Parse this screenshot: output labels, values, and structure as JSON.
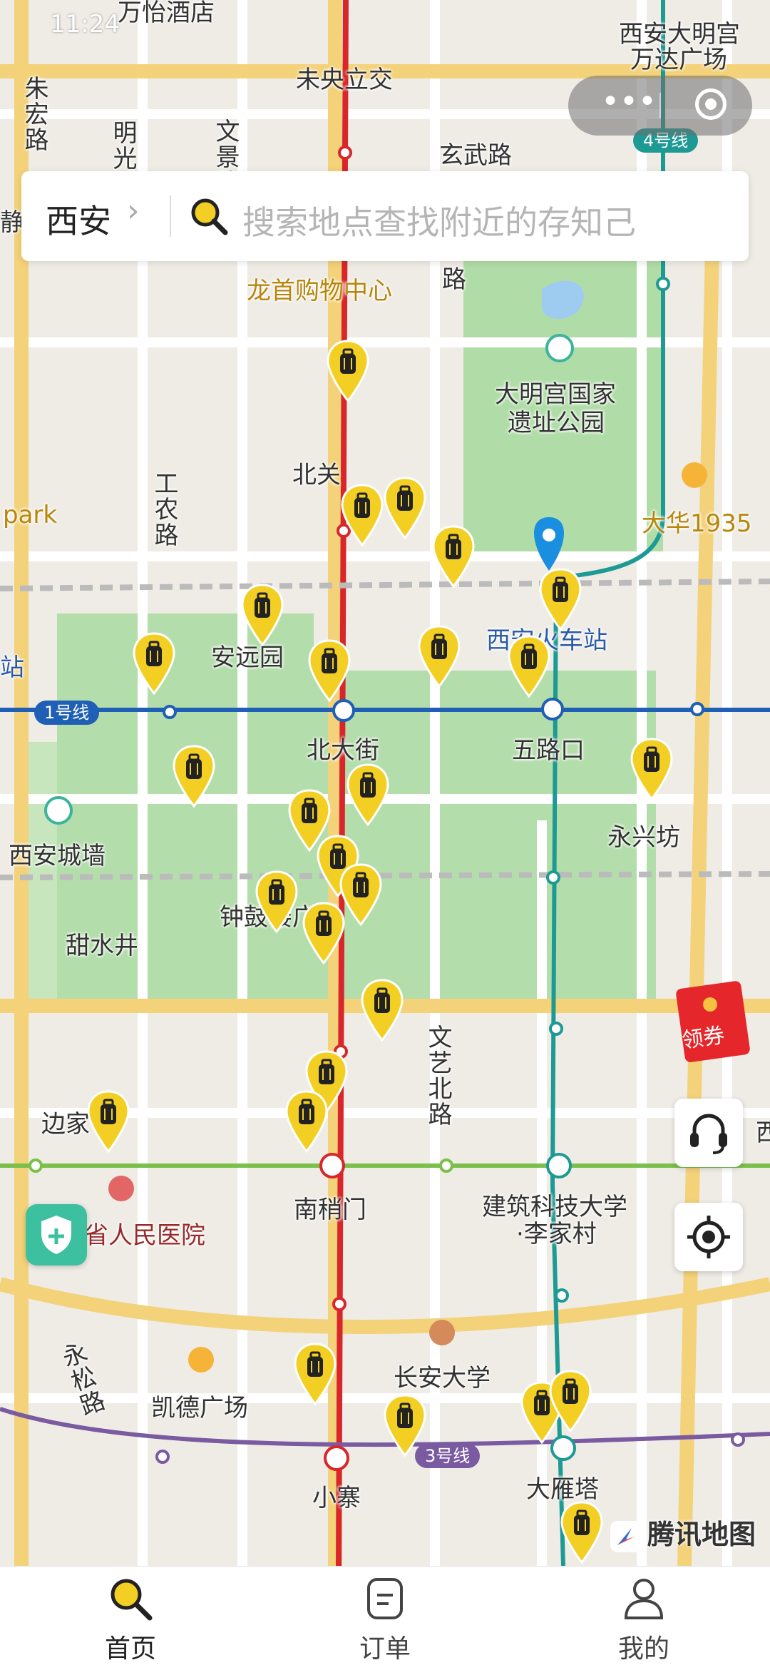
{
  "status_bar": {
    "time": "11:24"
  },
  "search": {
    "city": "西安",
    "city_chevron": "›",
    "placeholder": "搜索地点查找附近的存知己"
  },
  "capsule": {
    "more_label": "•••"
  },
  "map": {
    "labels": [
      {
        "text": "万怡酒店"
      },
      {
        "text": "西安大明宫"
      },
      {
        "text": "万达广场"
      },
      {
        "text": "未央立交"
      },
      {
        "text": "朱宏路"
      },
      {
        "text": "明光路"
      },
      {
        "text": "文景路"
      },
      {
        "text": "玄武路"
      },
      {
        "text": "路"
      },
      {
        "text": "静县"
      },
      {
        "text": "龙首购物中心"
      },
      {
        "text": "大明宫国家"
      },
      {
        "text": "遗址公园"
      },
      {
        "text": "北关"
      },
      {
        "text": "工农路"
      },
      {
        "text": "park"
      },
      {
        "text": "大华1935"
      },
      {
        "text": "西安火车站"
      },
      {
        "text": "安远园"
      },
      {
        "text": "站"
      },
      {
        "text": "北大街"
      },
      {
        "text": "五路口"
      },
      {
        "text": "永兴坊"
      },
      {
        "text": "西安城墙"
      },
      {
        "text": "钟鼓楼广场"
      },
      {
        "text": "甜水井"
      },
      {
        "text": "文艺北路"
      },
      {
        "text": "边家"
      },
      {
        "text": "西"
      },
      {
        "text": "省人民医院"
      },
      {
        "text": "南稍门"
      },
      {
        "text": "建筑科技大学"
      },
      {
        "text": "·李家村"
      },
      {
        "text": "永松路"
      },
      {
        "text": "长安大学"
      },
      {
        "text": "凯德广场"
      },
      {
        "text": "小寨"
      },
      {
        "text": "大雁塔"
      }
    ],
    "metro_badges": [
      {
        "text": "4号线",
        "color": "#1e9a94"
      },
      {
        "text": "1号线",
        "color": "#1f5fb5"
      },
      {
        "text": "3号线",
        "color": "#7a5aa0"
      }
    ],
    "storage_pins_count": 30,
    "pin_color": "#f2cf22"
  },
  "coupon": {
    "label": "领券"
  },
  "attribution": {
    "text": "腾讯地图"
  },
  "tabs": [
    {
      "label": "首页",
      "icon": "search-icon",
      "active": true
    },
    {
      "label": "订单",
      "icon": "order-icon",
      "active": false
    },
    {
      "label": "我的",
      "icon": "user-icon",
      "active": false
    }
  ]
}
